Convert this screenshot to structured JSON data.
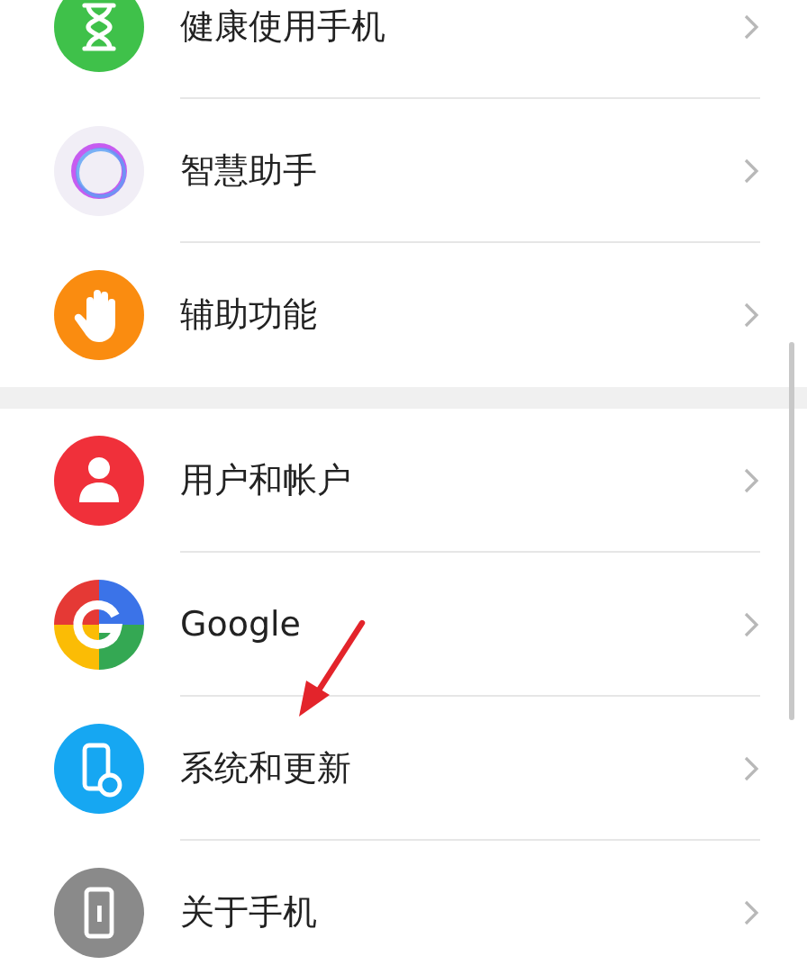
{
  "sections": [
    {
      "items": [
        {
          "kind": "hourglass",
          "label": "健康使用手机"
        },
        {
          "kind": "assistant",
          "label": "智慧助手"
        },
        {
          "kind": "hand",
          "label": "辅助功能"
        }
      ]
    },
    {
      "items": [
        {
          "kind": "user",
          "label": "用户和帐户"
        },
        {
          "kind": "google",
          "label": "Google"
        },
        {
          "kind": "system",
          "label": "系统和更新"
        },
        {
          "kind": "about",
          "label": "关于手机"
        }
      ]
    }
  ]
}
